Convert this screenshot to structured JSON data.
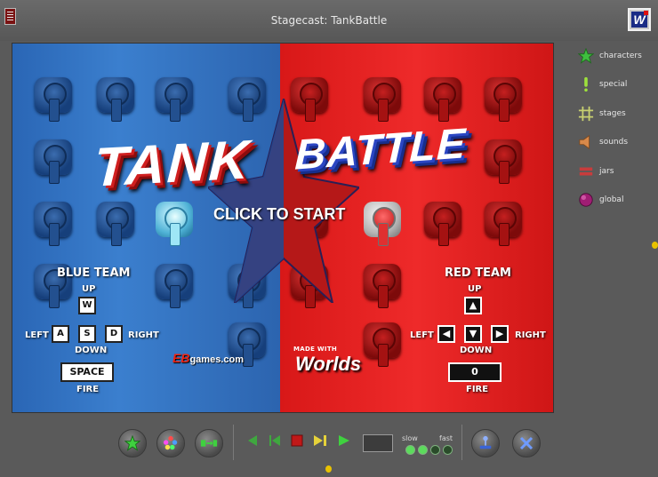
{
  "window": {
    "title": "Stagecast: TankBattle",
    "logo_letter": "W"
  },
  "stage": {
    "logo_tank": "TANK",
    "logo_battle": "BATTLE",
    "click_to_start": "CLICK TO START",
    "blue_team": {
      "label": "BLUE TEAM",
      "up": "UP",
      "down": "DOWN",
      "left": "LEFT",
      "right": "RIGHT",
      "fire": "FIRE",
      "keys": {
        "up": "W",
        "left": "A",
        "down": "S",
        "right": "D",
        "fire": "SPACE"
      }
    },
    "red_team": {
      "label": "RED TEAM",
      "up": "UP",
      "down": "DOWN",
      "left": "LEFT",
      "right": "RIGHT",
      "fire": "FIRE",
      "keys": {
        "up": "▲",
        "left": "◀",
        "down": "▼",
        "right": "▶",
        "score": "0"
      }
    },
    "eb_brand": "EB",
    "eb_suffix": "games.com",
    "made_with": "MADE WITH",
    "worlds": "Worlds"
  },
  "palette": {
    "items": [
      {
        "label": "characters",
        "icon": "star-icon"
      },
      {
        "label": "special",
        "icon": "exclamation-icon"
      },
      {
        "label": "stages",
        "icon": "grid-icon"
      },
      {
        "label": "sounds",
        "icon": "speaker-icon"
      },
      {
        "label": "jars",
        "icon": "jar-icon"
      },
      {
        "label": "global",
        "icon": "globe-icon"
      }
    ]
  },
  "controls": {
    "speed_slow": "slow",
    "speed_fast": "fast",
    "speed_level": 2,
    "speed_levels": 4
  },
  "colors": {
    "blue_team": "#3b7fce",
    "red_team": "#ee2a2a",
    "accent_green": "#3fd13f"
  }
}
